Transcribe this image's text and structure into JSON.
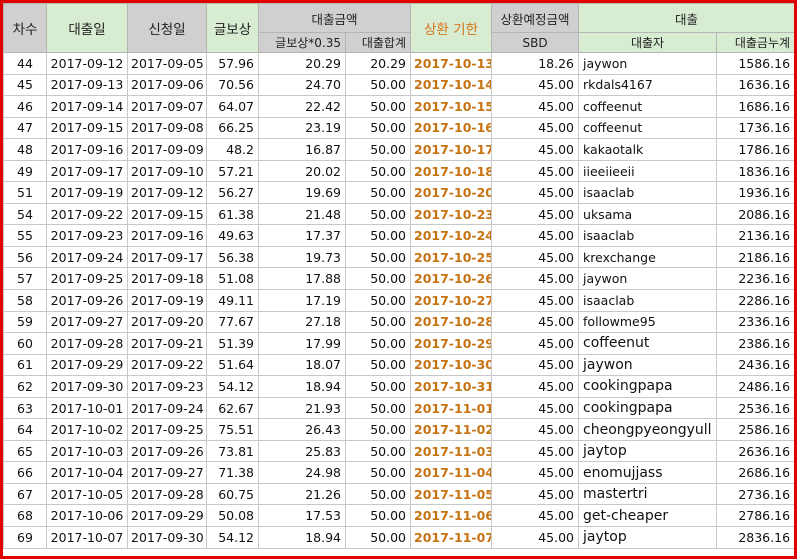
{
  "headers": {
    "no": "차수",
    "loan_date": "대출일",
    "apply_date": "신청일",
    "reward": "글보상",
    "loan_amount": "대출금액",
    "reward_035": "글보상*0.35",
    "loan_total": "대출합계",
    "due": "상환 기한",
    "expected": "상환예정금액",
    "sbd": "SBD",
    "loan": "대출",
    "borrower": "대출자",
    "cumulative": "대출금누계"
  },
  "colors": {
    "header_gray": "#d0d0d0",
    "header_green": "#d8ecd2",
    "due_text": "#c77312",
    "frame_border": "#e00000"
  },
  "rows": [
    {
      "no": "44",
      "loan_date": "2017-09-12",
      "apply_date": "2017-09-05",
      "reward": "57.96",
      "r035": "20.29",
      "total": "20.29",
      "due": "2017-10-13",
      "sbd": "18.26",
      "name": "jaywon",
      "cum": "1586.16"
    },
    {
      "no": "45",
      "loan_date": "2017-09-13",
      "apply_date": "2017-09-06",
      "reward": "70.56",
      "r035": "24.70",
      "total": "50.00",
      "due": "2017-10-14",
      "sbd": "45.00",
      "name": "rkdals4167",
      "cum": "1636.16"
    },
    {
      "no": "46",
      "loan_date": "2017-09-14",
      "apply_date": "2017-09-07",
      "reward": "64.07",
      "r035": "22.42",
      "total": "50.00",
      "due": "2017-10-15",
      "sbd": "45.00",
      "name": "coffeenut",
      "cum": "1686.16"
    },
    {
      "no": "47",
      "loan_date": "2017-09-15",
      "apply_date": "2017-09-08",
      "reward": "66.25",
      "r035": "23.19",
      "total": "50.00",
      "due": "2017-10-16",
      "sbd": "45.00",
      "name": "coffeenut",
      "cum": "1736.16"
    },
    {
      "no": "48",
      "loan_date": "2017-09-16",
      "apply_date": "2017-09-09",
      "reward": "48.2",
      "r035": "16.87",
      "total": "50.00",
      "due": "2017-10-17",
      "sbd": "45.00",
      "name": "kakaotalk",
      "cum": "1786.16"
    },
    {
      "no": "49",
      "loan_date": "2017-09-17",
      "apply_date": "2017-09-10",
      "reward": "57.21",
      "r035": "20.02",
      "total": "50.00",
      "due": "2017-10-18",
      "sbd": "45.00",
      "name": "iieeiieeii",
      "cum": "1836.16"
    },
    {
      "no": "51",
      "loan_date": "2017-09-19",
      "apply_date": "2017-09-12",
      "reward": "56.27",
      "r035": "19.69",
      "total": "50.00",
      "due": "2017-10-20",
      "sbd": "45.00",
      "name": "isaaclab",
      "cum": "1936.16"
    },
    {
      "no": "54",
      "loan_date": "2017-09-22",
      "apply_date": "2017-09-15",
      "reward": "61.38",
      "r035": "21.48",
      "total": "50.00",
      "due": "2017-10-23",
      "sbd": "45.00",
      "name": "uksama",
      "cum": "2086.16"
    },
    {
      "no": "55",
      "loan_date": "2017-09-23",
      "apply_date": "2017-09-16",
      "reward": "49.63",
      "r035": "17.37",
      "total": "50.00",
      "due": "2017-10-24",
      "sbd": "45.00",
      "name": "isaaclab",
      "cum": "2136.16"
    },
    {
      "no": "56",
      "loan_date": "2017-09-24",
      "apply_date": "2017-09-17",
      "reward": "56.38",
      "r035": "19.73",
      "total": "50.00",
      "due": "2017-10-25",
      "sbd": "45.00",
      "name": "krexchange",
      "cum": "2186.16"
    },
    {
      "no": "57",
      "loan_date": "2017-09-25",
      "apply_date": "2017-09-18",
      "reward": "51.08",
      "r035": "17.88",
      "total": "50.00",
      "due": "2017-10-26",
      "sbd": "45.00",
      "name": "jaywon",
      "cum": "2236.16"
    },
    {
      "no": "58",
      "loan_date": "2017-09-26",
      "apply_date": "2017-09-19",
      "reward": "49.11",
      "r035": "17.19",
      "total": "50.00",
      "due": "2017-10-27",
      "sbd": "45.00",
      "name": "isaaclab",
      "cum": "2286.16"
    },
    {
      "no": "59",
      "loan_date": "2017-09-27",
      "apply_date": "2017-09-20",
      "reward": "77.67",
      "r035": "27.18",
      "total": "50.00",
      "due": "2017-10-28",
      "sbd": "45.00",
      "name": "followme95",
      "cum": "2336.16"
    },
    {
      "no": "60",
      "loan_date": "2017-09-28",
      "apply_date": "2017-09-21",
      "reward": "51.39",
      "r035": "17.99",
      "total": "50.00",
      "due": "2017-10-29",
      "sbd": "45.00",
      "name": "coffeenut",
      "cum": "2386.16",
      "big": true
    },
    {
      "no": "61",
      "loan_date": "2017-09-29",
      "apply_date": "2017-09-22",
      "reward": "51.64",
      "r035": "18.07",
      "total": "50.00",
      "due": "2017-10-30",
      "sbd": "45.00",
      "name": "jaywon",
      "cum": "2436.16",
      "big": true
    },
    {
      "no": "62",
      "loan_date": "2017-09-30",
      "apply_date": "2017-09-23",
      "reward": "54.12",
      "r035": "18.94",
      "total": "50.00",
      "due": "2017-10-31",
      "sbd": "45.00",
      "name": "cookingpapa",
      "cum": "2486.16",
      "big": true
    },
    {
      "no": "63",
      "loan_date": "2017-10-01",
      "apply_date": "2017-09-24",
      "reward": "62.67",
      "r035": "21.93",
      "total": "50.00",
      "due": "2017-11-01",
      "sbd": "45.00",
      "name": "cookingpapa",
      "cum": "2536.16",
      "big": true
    },
    {
      "no": "64",
      "loan_date": "2017-10-02",
      "apply_date": "2017-09-25",
      "reward": "75.51",
      "r035": "26.43",
      "total": "50.00",
      "due": "2017-11-02",
      "sbd": "45.00",
      "name": "cheongpyeongyull",
      "cum": "2586.16",
      "big": true
    },
    {
      "no": "65",
      "loan_date": "2017-10-03",
      "apply_date": "2017-09-26",
      "reward": "73.81",
      "r035": "25.83",
      "total": "50.00",
      "due": "2017-11-03",
      "sbd": "45.00",
      "name": "jaytop",
      "cum": "2636.16",
      "big": true
    },
    {
      "no": "66",
      "loan_date": "2017-10-04",
      "apply_date": "2017-09-27",
      "reward": "71.38",
      "r035": "24.98",
      "total": "50.00",
      "due": "2017-11-04",
      "sbd": "45.00",
      "name": "enomujjass",
      "cum": "2686.16",
      "big": true
    },
    {
      "no": "67",
      "loan_date": "2017-10-05",
      "apply_date": "2017-09-28",
      "reward": "60.75",
      "r035": "21.26",
      "total": "50.00",
      "due": "2017-11-05",
      "sbd": "45.00",
      "name": "mastertri",
      "cum": "2736.16",
      "big": true
    },
    {
      "no": "68",
      "loan_date": "2017-10-06",
      "apply_date": "2017-09-29",
      "reward": "50.08",
      "r035": "17.53",
      "total": "50.00",
      "due": "2017-11-06",
      "sbd": "45.00",
      "name": "get-cheaper",
      "cum": "2786.16",
      "big": true
    },
    {
      "no": "69",
      "loan_date": "2017-10-07",
      "apply_date": "2017-09-30",
      "reward": "54.12",
      "r035": "18.94",
      "total": "50.00",
      "due": "2017-11-07",
      "sbd": "45.00",
      "name": "jaytop",
      "cum": "2836.16",
      "big": true
    }
  ]
}
